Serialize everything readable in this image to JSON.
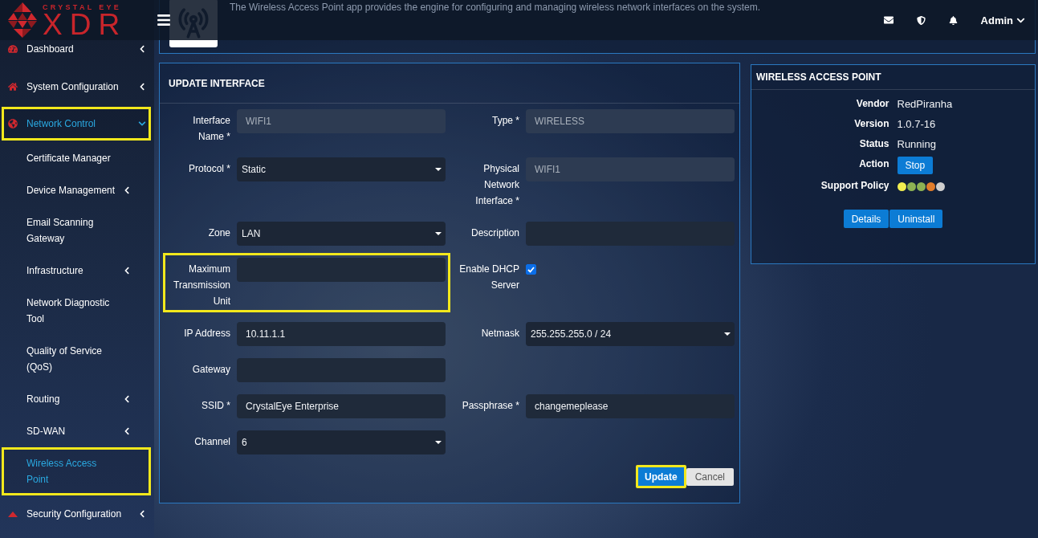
{
  "logo": {
    "brand": "CRYSTAL EYE",
    "product": "XDR"
  },
  "top_bar": {
    "user": "Admin"
  },
  "sidebar": {
    "items": [
      {
        "label": "Dashboard",
        "selected": false,
        "highlighted": false,
        "expanded": false
      },
      {
        "label": "System Configuration",
        "selected": false,
        "highlighted": false,
        "expanded": false
      },
      {
        "label": "Network Control",
        "selected": true,
        "highlighted": true,
        "expanded": true,
        "children": [
          {
            "label": "Certificate Manager",
            "selected": false,
            "highlighted": false
          },
          {
            "label": "Device Management",
            "selected": false,
            "highlighted": false,
            "expanded": false
          },
          {
            "label": "Email Scanning Gateway",
            "selected": false,
            "highlighted": false
          },
          {
            "label": "Infrastructure",
            "selected": false,
            "highlighted": false,
            "expanded": false
          },
          {
            "label": "Network Diagnostic Tool",
            "selected": false,
            "highlighted": false
          },
          {
            "label": "Quality of Service (QoS)",
            "selected": false,
            "highlighted": false
          },
          {
            "label": "Routing",
            "selected": false,
            "highlighted": false,
            "expanded": false
          },
          {
            "label": "SD-WAN",
            "selected": false,
            "highlighted": false,
            "expanded": false
          },
          {
            "label": "Wireless Access Point",
            "selected": true,
            "highlighted": true
          }
        ]
      },
      {
        "label": "Security Configuration",
        "selected": false,
        "highlighted": false,
        "expanded": false
      }
    ]
  },
  "app_info": {
    "description": "The Wireless Access Point app provides the engine for configuring and managing wireless network interfaces on the system."
  },
  "form": {
    "title": "UPDATE INTERFACE",
    "rows": [
      {
        "fields": [
          {
            "label": "Interface Name *",
            "kind": "text",
            "value": "WIFI1",
            "disabled": true,
            "highlighted": false
          },
          {
            "label": "Type *",
            "kind": "text",
            "value": "WIRELESS",
            "disabled": true,
            "highlighted": false
          }
        ]
      },
      {
        "fields": [
          {
            "label": "Protocol *",
            "kind": "select",
            "value": "Static",
            "disabled": false,
            "highlighted": false
          },
          {
            "label": "Physical Network Interface *",
            "kind": "text",
            "value": "WIFI1",
            "disabled": true,
            "highlighted": false
          }
        ]
      },
      {
        "fields": [
          {
            "label": "Zone",
            "kind": "select",
            "value": "LAN",
            "disabled": false,
            "highlighted": false
          },
          {
            "label": "Description",
            "kind": "text",
            "disabled": false,
            "highlighted": false
          }
        ]
      },
      {
        "fields": [
          {
            "label": "Maximum Transmission Unit",
            "kind": "text",
            "disabled": false,
            "highlighted": true
          },
          {
            "label": "Enable DHCP Server",
            "kind": "checkbox",
            "checked": true,
            "disabled": false,
            "highlighted": false
          }
        ]
      },
      {
        "fields": [
          {
            "label": "IP Address",
            "kind": "text",
            "value": "10.11.1.1",
            "disabled": false,
            "highlighted": false
          },
          {
            "label": "Netmask",
            "kind": "select",
            "value": "255.255.255.0 / 24",
            "disabled": false,
            "highlighted": false
          }
        ]
      },
      {
        "fields": [
          {
            "label": "Gateway",
            "kind": "text",
            "disabled": false,
            "highlighted": false
          }
        ]
      },
      {
        "fields": [
          {
            "label": "SSID *",
            "kind": "text",
            "value": "CrystalEye Enterprise",
            "disabled": false,
            "highlighted": false
          },
          {
            "label": "Passphrase *",
            "kind": "text",
            "value": "changemeplease",
            "disabled": false,
            "highlighted": false
          }
        ]
      },
      {
        "fields": [
          {
            "label": "Channel",
            "kind": "select",
            "value": "6",
            "disabled": false,
            "highlighted": false
          }
        ]
      }
    ],
    "buttons": [
      {
        "label": "Update",
        "kind": "primary",
        "highlighted": true
      },
      {
        "label": "Cancel",
        "kind": "secondary",
        "highlighted": false
      }
    ]
  },
  "app_panel": {
    "title": "WIRELESS ACCESS POINT",
    "details": [
      {
        "label": "Vendor",
        "value": "RedPiranha"
      },
      {
        "label": "Version",
        "value": "1.0.7-16"
      },
      {
        "label": "Status",
        "value": "Running"
      }
    ],
    "action": {
      "label": "Action",
      "button": "Stop"
    },
    "support_policy": {
      "label": "Support Policy",
      "dots": [
        {
          "color": "#f2ee50"
        },
        {
          "color": "#8db253"
        },
        {
          "color": "#8db253"
        },
        {
          "color": "#e27d2b"
        },
        {
          "color": "#cfcfcf"
        }
      ]
    },
    "buttons": [
      "Details",
      "Uninstall"
    ]
  }
}
